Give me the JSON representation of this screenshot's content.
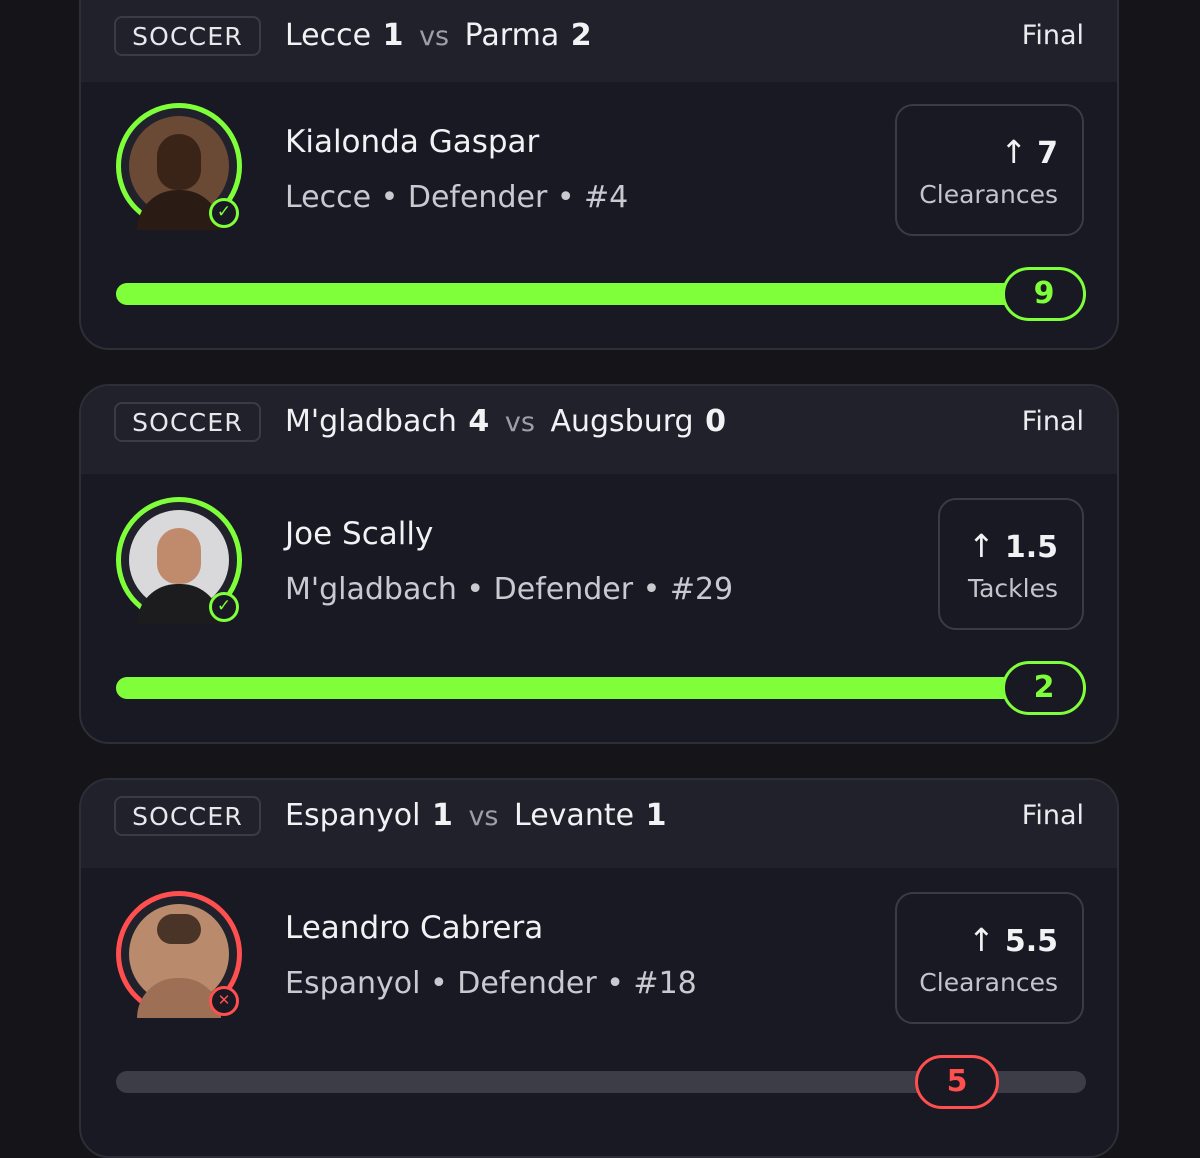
{
  "cards": [
    {
      "sport": "SOCCER",
      "home_team": "Lecce",
      "home_score": "1",
      "vs": "vs",
      "away_team": "Parma",
      "away_score": "2",
      "status": "Final",
      "player": {
        "name": "Kialonda Gaspar",
        "meta": "Lecce • Defender • #4"
      },
      "stat": {
        "arrow": "↑",
        "line": "7",
        "label": "Clearances"
      },
      "result": {
        "outcome": "hit",
        "icon": "check-icon",
        "glyph": "✓",
        "value": "9",
        "progress": 1.0,
        "color": "#7fff3a"
      }
    },
    {
      "sport": "SOCCER",
      "home_team": "M'gladbach",
      "home_score": "4",
      "vs": "vs",
      "away_team": "Augsburg",
      "away_score": "0",
      "status": "Final",
      "player": {
        "name": "Joe Scally",
        "meta": "M'gladbach • Defender • #29"
      },
      "stat": {
        "arrow": "↑",
        "line": "1.5",
        "label": "Tackles"
      },
      "result": {
        "outcome": "hit",
        "icon": "check-icon",
        "glyph": "✓",
        "value": "2",
        "progress": 1.0,
        "color": "#7fff3a"
      }
    },
    {
      "sport": "SOCCER",
      "home_team": "Espanyol",
      "home_score": "1",
      "vs": "vs",
      "away_team": "Levante",
      "away_score": "1",
      "status": "Final",
      "player": {
        "name": "Leandro Cabrera",
        "meta": "Espanyol • Defender • #18"
      },
      "stat": {
        "arrow": "↑",
        "line": "5.5",
        "label": "Clearances"
      },
      "result": {
        "outcome": "miss",
        "icon": "x-icon",
        "glyph": "✕",
        "value": "5",
        "progress": 0.91,
        "color": "#ff4f4f"
      }
    }
  ]
}
